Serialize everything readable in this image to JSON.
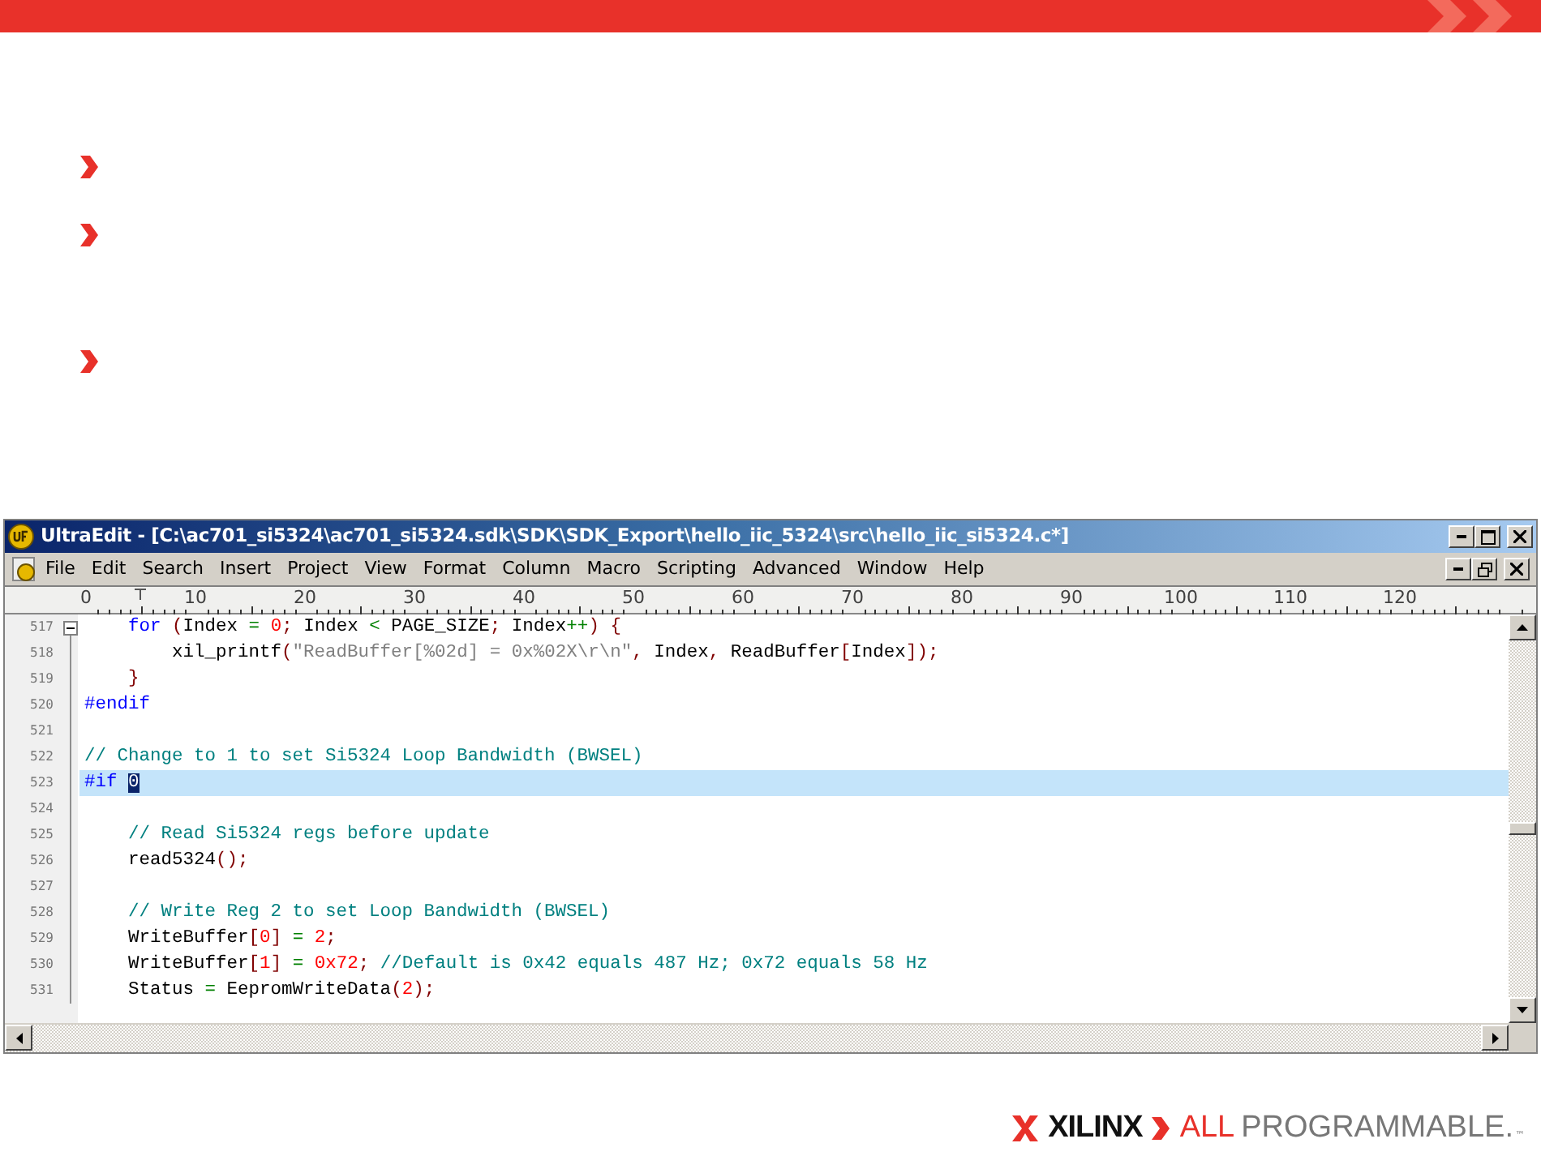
{
  "slide": {
    "bullets": [
      {
        "kind": "chevron"
      },
      {
        "kind": "chevron"
      },
      {
        "kind": "chevron"
      }
    ]
  },
  "window": {
    "title": "UltraEdit - [C:\\ac701_si5324\\ac701_si5324.sdk\\SDK\\SDK_Export\\hello_iic_5324\\src\\hello_iic_si5324.c*]",
    "menu": [
      "File",
      "Edit",
      "Search",
      "Insert",
      "Project",
      "View",
      "Format",
      "Column",
      "Macro",
      "Scripting",
      "Advanced",
      "Window",
      "Help"
    ],
    "ruler": [
      "0",
      "10",
      "20",
      "30",
      "40",
      "50",
      "60",
      "70",
      "80",
      "90",
      "100",
      "110",
      "120"
    ],
    "lines": [
      {
        "number": "517",
        "current": false,
        "fold": true,
        "tokens": [
          {
            "kind": "keyword",
            "text": "    for"
          },
          {
            "kind": "punct",
            "text": " ("
          },
          {
            "kind": "plain",
            "text": "Index"
          },
          {
            "kind": "operator",
            "text": " ="
          },
          {
            "kind": "number",
            "text": " 0"
          },
          {
            "kind": "punct",
            "text": ";"
          },
          {
            "kind": "plain",
            "text": " Index"
          },
          {
            "kind": "operator",
            "text": " <"
          },
          {
            "kind": "plain",
            "text": " PAGE_SIZE"
          },
          {
            "kind": "punct",
            "text": ";"
          },
          {
            "kind": "plain",
            "text": " Index"
          },
          {
            "kind": "operator",
            "text": "++"
          },
          {
            "kind": "punct",
            "text": ") {"
          }
        ]
      },
      {
        "number": "518",
        "current": false,
        "fold": false,
        "tokens": [
          {
            "kind": "plain",
            "text": "        xil_printf"
          },
          {
            "kind": "punct",
            "text": "("
          },
          {
            "kind": "string",
            "text": "\"ReadBuffer[%02d] = 0x%02X\\r\\n\""
          },
          {
            "kind": "punct",
            "text": ","
          },
          {
            "kind": "plain",
            "text": " Index"
          },
          {
            "kind": "punct",
            "text": ","
          },
          {
            "kind": "plain",
            "text": " ReadBuffer"
          },
          {
            "kind": "punct",
            "text": "["
          },
          {
            "kind": "plain",
            "text": "Index"
          },
          {
            "kind": "punct",
            "text": "]);"
          }
        ]
      },
      {
        "number": "519",
        "current": false,
        "fold": false,
        "tokens": [
          {
            "kind": "punct",
            "text": "    }"
          }
        ]
      },
      {
        "number": "520",
        "current": false,
        "fold": false,
        "tokens": [
          {
            "kind": "keyword",
            "text": "#endif"
          }
        ]
      },
      {
        "number": "521",
        "current": false,
        "fold": false
      },
      {
        "number": "522",
        "current": false,
        "fold": false,
        "tokens": [
          {
            "kind": "comment",
            "text": "// Change to 1 to set Si5324 Loop Bandwidth (BWSEL)"
          }
        ]
      },
      {
        "number": "523",
        "current": true,
        "fold": false,
        "tokens": [
          {
            "kind": "keyword",
            "text": "#if "
          },
          {
            "kind": "selection",
            "text": "0"
          }
        ]
      },
      {
        "number": "524",
        "current": false,
        "fold": false
      },
      {
        "number": "525",
        "current": false,
        "fold": false,
        "tokens": [
          {
            "kind": "comment",
            "text": "    // Read Si5324 regs before update"
          }
        ]
      },
      {
        "number": "526",
        "current": false,
        "fold": false,
        "tokens": [
          {
            "kind": "plain",
            "text": "    read5324"
          },
          {
            "kind": "punct",
            "text": "();"
          }
        ]
      },
      {
        "number": "527",
        "current": false,
        "fold": false
      },
      {
        "number": "528",
        "current": false,
        "fold": false,
        "tokens": [
          {
            "kind": "comment",
            "text": "    // Write Reg 2 to set Loop Bandwidth (BWSEL)"
          }
        ]
      },
      {
        "number": "529",
        "current": false,
        "fold": false,
        "tokens": [
          {
            "kind": "plain",
            "text": "    WriteBuffer"
          },
          {
            "kind": "punct",
            "text": "["
          },
          {
            "kind": "number",
            "text": "0"
          },
          {
            "kind": "punct",
            "text": "]"
          },
          {
            "kind": "operator",
            "text": " ="
          },
          {
            "kind": "number",
            "text": " 2"
          },
          {
            "kind": "punct",
            "text": ";"
          }
        ]
      },
      {
        "number": "530",
        "current": false,
        "fold": false,
        "tokens": [
          {
            "kind": "plain",
            "text": "    WriteBuffer"
          },
          {
            "kind": "punct",
            "text": "["
          },
          {
            "kind": "number",
            "text": "1"
          },
          {
            "kind": "punct",
            "text": "]"
          },
          {
            "kind": "operator",
            "text": " ="
          },
          {
            "kind": "number",
            "text": " 0x72"
          },
          {
            "kind": "punct",
            "text": ";"
          },
          {
            "kind": "comment",
            "text": " //Default is 0x42 equals 487 Hz; 0x72 equals 58 Hz"
          }
        ]
      },
      {
        "number": "531",
        "current": false,
        "fold": false,
        "tokens": [
          {
            "kind": "plain",
            "text": "    Status"
          },
          {
            "kind": "operator",
            "text": " ="
          },
          {
            "kind": "plain",
            "text": " EepromWriteData"
          },
          {
            "kind": "punct",
            "text": "("
          },
          {
            "kind": "number",
            "text": "2"
          },
          {
            "kind": "punct",
            "text": ");"
          }
        ]
      }
    ]
  },
  "footer": {
    "brand": "XILINX",
    "tagline_accent": "ALL",
    "tagline": "PROGRAMMABLE.",
    "trademark": "™"
  }
}
